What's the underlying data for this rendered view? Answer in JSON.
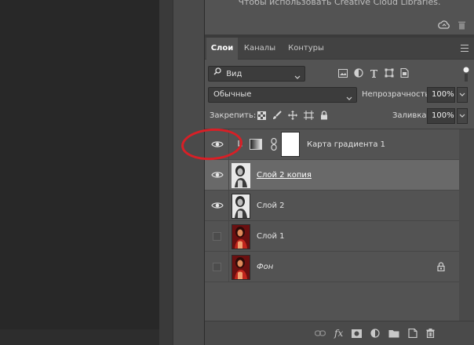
{
  "libraries": {
    "message": "Чтобы использовать Creative Cloud Libraries.",
    "icons": [
      "creative-cloud-sync-icon",
      "trash-icon"
    ]
  },
  "tabs": [
    {
      "label": "Слои",
      "active": true
    },
    {
      "label": "Каналы",
      "active": false
    },
    {
      "label": "Контуры",
      "active": false
    }
  ],
  "filter": {
    "kind_label": "Вид",
    "icons": [
      "pixel-layer-filter-icon",
      "adjustment-layer-filter-icon",
      "type-layer-filter-icon",
      "shape-layer-filter-icon",
      "smart-object-filter-icon"
    ]
  },
  "blend": {
    "mode": "Обычные",
    "opacity_label": "Непрозрачность:",
    "opacity_value": "100%"
  },
  "lock": {
    "label": "Закрепить:",
    "icons": [
      "lock-transparent-icon",
      "lock-image-icon",
      "lock-position-icon",
      "lock-artboard-icon",
      "lock-all-icon"
    ],
    "fill_label": "Заливка:",
    "fill_value": "100%"
  },
  "layers": [
    {
      "name": "Карта градиента 1",
      "visible": true,
      "selected": false,
      "type": "gradient-map",
      "clipped": true
    },
    {
      "name": "Слой 2 копия",
      "visible": true,
      "selected": true,
      "type": "bw-photo"
    },
    {
      "name": "Слой 2",
      "visible": true,
      "selected": false,
      "type": "bw-photo"
    },
    {
      "name": "Слой 1",
      "visible": false,
      "selected": false,
      "type": "color-photo"
    },
    {
      "name": "Фон",
      "visible": false,
      "selected": false,
      "type": "color-photo",
      "locked": true
    }
  ],
  "bottom_bar": {
    "fx_label": "fx",
    "icons": [
      "link-layers-icon",
      "fx-icon",
      "add-mask-icon",
      "new-adjustment-icon",
      "new-group-icon",
      "new-layer-icon",
      "delete-layer-icon"
    ]
  },
  "annotation": {
    "color": "#d81f26"
  }
}
